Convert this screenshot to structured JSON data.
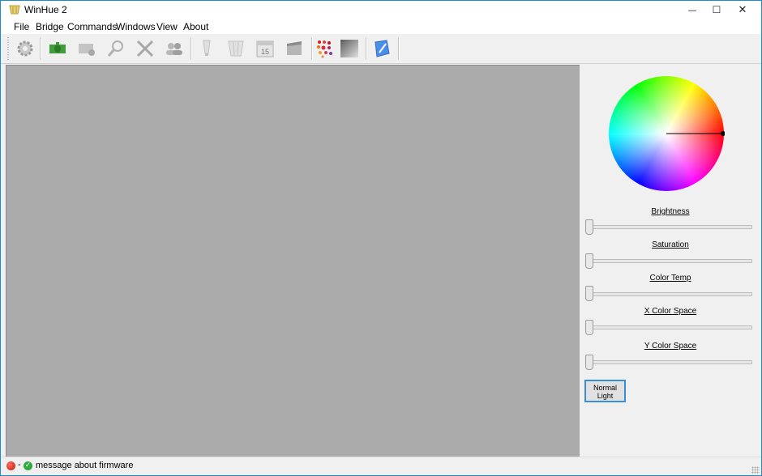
{
  "window": {
    "title": "WinHue 2",
    "minimize_glyph": "—",
    "maximize_glyph": "☐",
    "close_glyph": "✕"
  },
  "menu": [
    {
      "label": "File"
    },
    {
      "label": "Bridge"
    },
    {
      "label": "Commands"
    },
    {
      "label": "Windows"
    },
    {
      "label": "View"
    },
    {
      "label": "About"
    }
  ],
  "toolbar": {
    "tools": [
      {
        "icon": "settings-gear-icon"
      },
      {
        "icon": "bridge-icon"
      },
      {
        "icon": "bridge-settings-icon"
      },
      {
        "icon": "search-icon"
      },
      {
        "icon": "tools-icon"
      },
      {
        "icon": "users-icon"
      },
      {
        "icon": "light-bulb-icon"
      },
      {
        "icon": "group-icon"
      },
      {
        "icon": "calendar-icon"
      },
      {
        "icon": "scene-icon"
      },
      {
        "icon": "color-dots-icon"
      },
      {
        "icon": "gradient-icon"
      },
      {
        "icon": "edit-icon"
      }
    ],
    "calendar_day": "15"
  },
  "panel": {
    "sliders": [
      {
        "label": "Brightness",
        "value": 0
      },
      {
        "label": "Saturation",
        "value": 0
      },
      {
        "label": "Color Temp",
        "value": 0
      },
      {
        "label": "X Color Space",
        "value": 0
      },
      {
        "label": "Y Color Space",
        "value": 0
      }
    ],
    "normal_light_button": "Normal\nLight"
  },
  "status": {
    "separator": "-",
    "message": "message about firmware",
    "check_glyph": "✓"
  },
  "colors": {
    "canvas": "#ababab",
    "window_border": "#1e8ad6",
    "button_focus": "#3a8ed6"
  }
}
